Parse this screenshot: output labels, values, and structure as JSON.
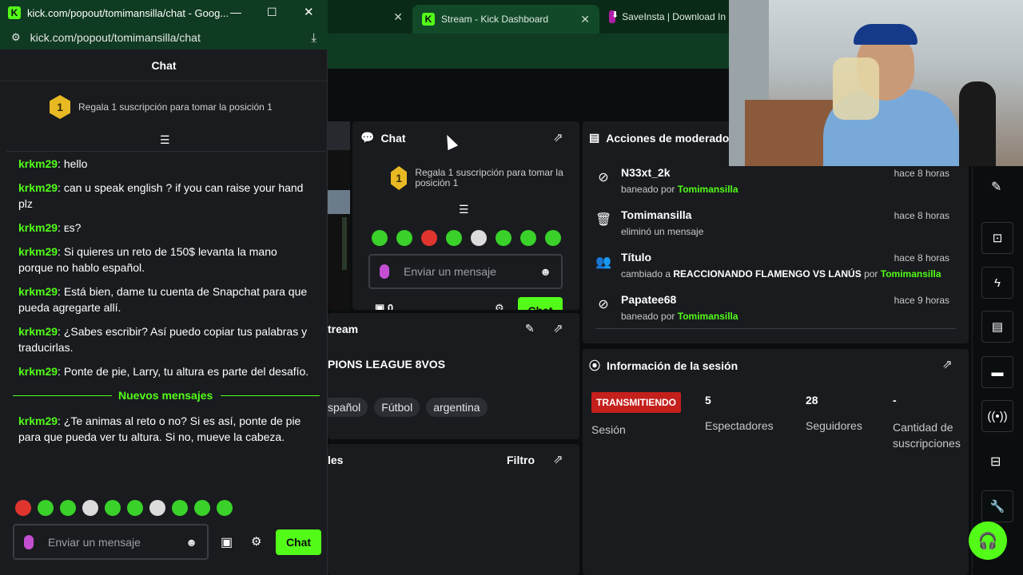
{
  "browser": {
    "tabs": [
      {
        "label": "Stream - Kick Dashboard",
        "active": true
      },
      {
        "label": "SaveInsta | Download In",
        "active": false
      }
    ]
  },
  "popout": {
    "window_title": "kick.com/popout/tomimansilla/chat - Goog...",
    "url": "kick.com/popout/tomimansilla/chat",
    "header": "Chat",
    "gift_banner": "Regala 1 suscripción para tomar la posición 1",
    "rank": "1",
    "messages": [
      {
        "user": "krkm29",
        "text": "hello"
      },
      {
        "user": "krkm29",
        "text": "can u speak english ? if you can raise your hand plz"
      },
      {
        "user": "krkm29",
        "text": "ᴇs?"
      },
      {
        "user": "krkm29",
        "text": "Si quieres un reto de 150$ levanta la mano porque no hablo español."
      },
      {
        "user": "krkm29",
        "text": "Está bien, dame tu cuenta de Snapchat para que pueda agregarte allí."
      },
      {
        "user": "krkm29",
        "text": "¿Sabes escribir? Así puedo copiar tus palabras y traducirlas."
      },
      {
        "user": "krkm29",
        "text": "Ponte de pie, Larry, tu altura es parte del desafío."
      }
    ],
    "new_messages_label": "Nuevos mensajes",
    "new_message": {
      "user": "krkm29",
      "text": "¿Te animas al reto o no? Si es así, ponte de pie para que pueda ver tu altura. Si no, mueve la cabeza."
    },
    "input_placeholder": "Enviar un mensaje",
    "send_label": "Chat"
  },
  "dashboard": {
    "chat_panel": {
      "title": "Chat",
      "gift_banner": "Regala 1 suscripción para tomar la posición 1",
      "rank": "1",
      "input_placeholder": "Enviar un mensaje",
      "count": "0",
      "send_label": "Chat"
    },
    "stream_panel": {
      "title_fragment": "tream",
      "stream_title_fragment": "PIONS LEAGUE 8VOS",
      "tags": [
        "spañol",
        "Fútbol",
        "argentina"
      ]
    },
    "lower_left_panel": {
      "title_fragment": "les",
      "filter_label": "Filtro"
    },
    "mod_panel": {
      "title": "Acciones de moderado",
      "actions": [
        {
          "name": "N33xt_2k",
          "time": "hace 8 horas",
          "pre": "baneado por",
          "bold": "",
          "mid": "",
          "by": "Tomimansilla",
          "icon": "ban-icon"
        },
        {
          "name": "Tomimansilla",
          "time": "hace 8 horas",
          "pre": "eliminó un mensaje",
          "bold": "",
          "mid": "",
          "by": "",
          "icon": "trash-icon"
        },
        {
          "name": "Título",
          "time": "hace 8 horas",
          "pre": "cambiado a",
          "bold": "REACCIONANDO FLAMENGO VS LANÚS",
          "mid": "por",
          "by": "Tomimansilla",
          "icon": "title-edit-icon"
        },
        {
          "name": "Papatee68",
          "time": "hace 9 horas",
          "pre": "baneado por",
          "bold": "",
          "mid": "",
          "by": "Tomimansilla",
          "icon": "ban-icon"
        }
      ]
    },
    "session_panel": {
      "title": "Información de la sesión",
      "live_badge": "TRANSMITIENDO",
      "session_label": "Sesión",
      "stats": [
        {
          "value": "5",
          "label": "Espectadores"
        },
        {
          "value": "28",
          "label": "Seguidores"
        },
        {
          "value": "-",
          "label": "Cantidad de suscripciones"
        }
      ]
    }
  },
  "colors": {
    "accent": "#53fc18",
    "live": "#e0352f",
    "panel": "#191b1f",
    "browser": "#0f3b22"
  }
}
